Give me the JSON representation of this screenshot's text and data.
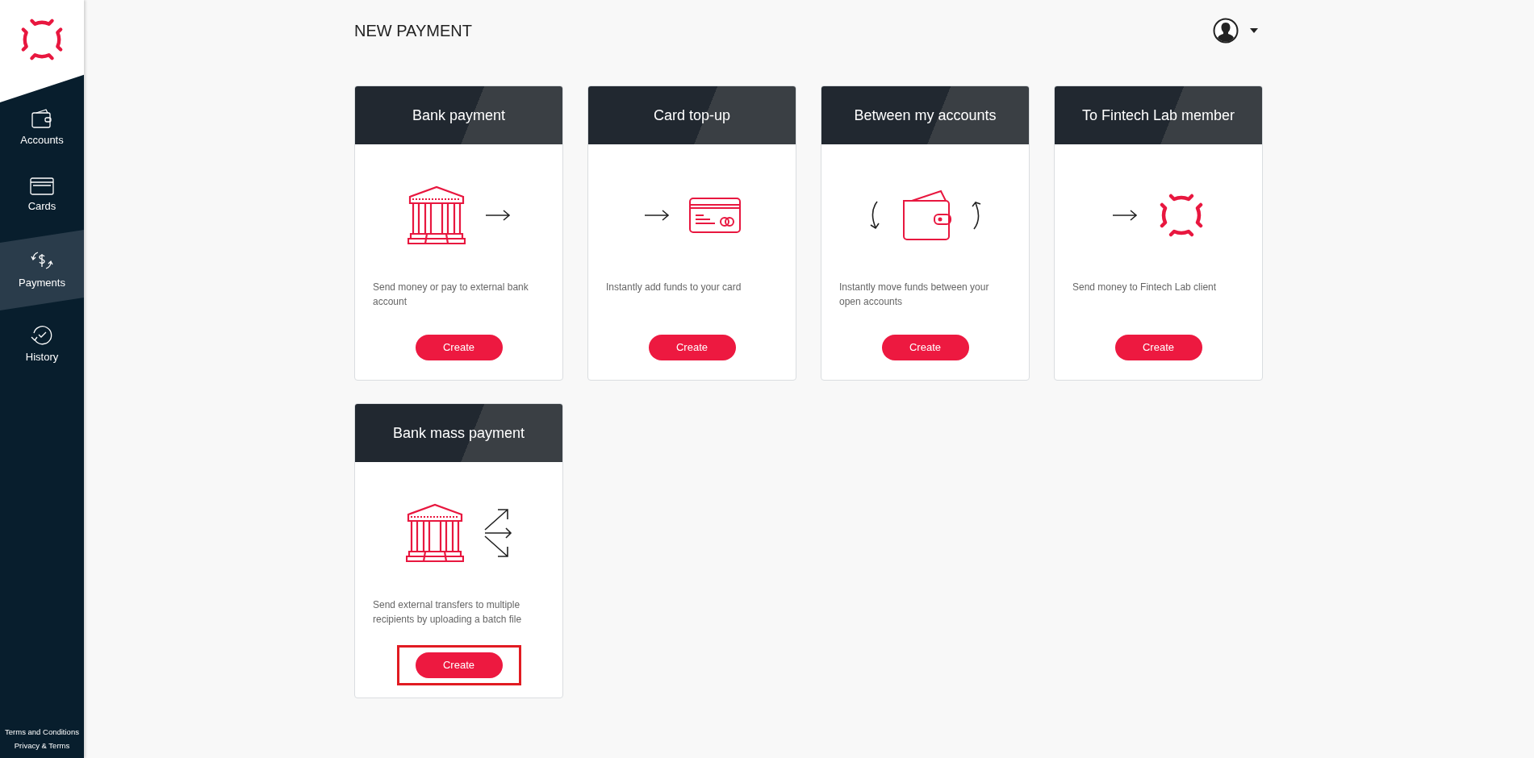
{
  "sidebar": {
    "nav": [
      {
        "label": "Accounts",
        "selected": false
      },
      {
        "label": "Cards",
        "selected": false
      },
      {
        "label": "Payments",
        "selected": true
      },
      {
        "label": "History",
        "selected": false
      }
    ],
    "footer_links": [
      "Terms and Conditions",
      "Privacy & Terms"
    ]
  },
  "page_title": "NEW PAYMENT",
  "cards": [
    {
      "title": "Bank payment",
      "description": "Send money or pay to external bank account",
      "button": "Create",
      "highlighted": false
    },
    {
      "title": "Card top-up",
      "description": "Instantly add funds to your card",
      "button": "Create",
      "highlighted": false
    },
    {
      "title": "Between my accounts",
      "description": "Instantly move funds between your open accounts",
      "button": "Create",
      "highlighted": false
    },
    {
      "title": "To Fintech Lab member",
      "description": "Send money to Fintech Lab client",
      "button": "Create",
      "highlighted": false
    },
    {
      "title": "Bank mass payment",
      "description": "Send external transfers to multiple recipients by uploading a batch file",
      "button": "Create",
      "highlighted": true
    }
  ]
}
